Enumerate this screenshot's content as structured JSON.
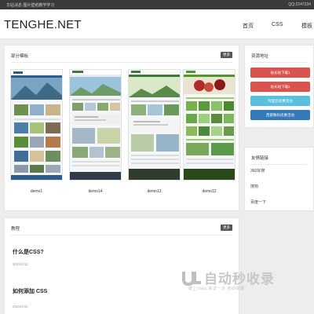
{
  "topbar": {
    "left_text": "华站消息 图片壁纸教学学习",
    "right_text": "QQ:2247234"
  },
  "header": {
    "logo": "TENGHE.NET",
    "nav": [
      "首页",
      "CSS",
      "模板"
    ]
  },
  "templates": {
    "title": "部分模板",
    "more_label": "更多",
    "items": [
      {
        "name": "demo1",
        "hero_text": "",
        "accent": "#2b5d8c"
      },
      {
        "name": "demo14",
        "hero_text": "",
        "accent": "#4a6a8c"
      },
      {
        "name": "demo13",
        "hero_text": "",
        "accent": "#3a7a3a"
      },
      {
        "name": "demo12",
        "hero_text": "",
        "accent": "#4a9a2a"
      }
    ]
  },
  "resources": {
    "title": "资源地址",
    "buttons": [
      {
        "label": "站长站下载1",
        "color": "#d9534f"
      },
      {
        "label": "站长站下载2",
        "color": "#d9534f"
      },
      {
        "label": "阿里云优惠活动",
        "color": "#5bc0de"
      },
      {
        "label": "西部数码优惠活动",
        "color": "#337ab7"
      }
    ]
  },
  "friend_links": {
    "title": "友情链接",
    "items": [
      "360好搜",
      "搜狗",
      "百度一下"
    ]
  },
  "tutorials": {
    "title": "教程",
    "more_label": "更多",
    "articles": [
      {
        "title": "什么是CSS?",
        "date": "2024/1/11"
      },
      {
        "title": "如何添加 CSS",
        "date": "2024/1/11"
      }
    ]
  },
  "watermark": {
    "main": "自动秒收录",
    "sub": "做上links 来访一次 自动收录"
  }
}
